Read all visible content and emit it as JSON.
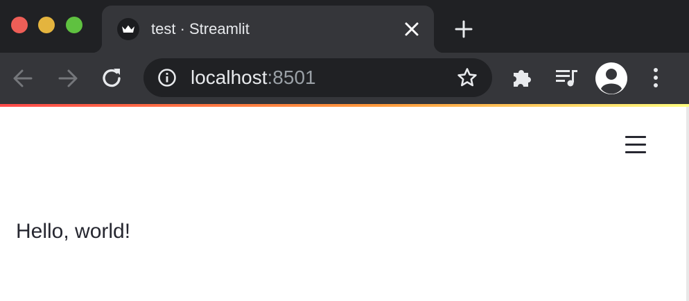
{
  "browser": {
    "tab": {
      "title": "test · Streamlit",
      "favicon": "streamlit-crown-icon"
    },
    "address_bar": {
      "host": "localhost",
      "port": ":8501"
    },
    "icons": {
      "back": "arrow-left-icon",
      "forward": "arrow-right-icon",
      "reload": "reload-icon",
      "info": "info-icon",
      "bookmark": "star-icon",
      "extensions": "puzzle-icon",
      "media": "media-queue-icon",
      "profile": "account-circle-icon",
      "menu": "kebab-menu-icon",
      "close_tab": "close-icon",
      "new_tab": "plus-icon"
    },
    "colors": {
      "tab_bar": "#202124",
      "toolbar": "#35363a",
      "text": "#e8eaed",
      "muted": "#9aa0a6"
    }
  },
  "app": {
    "body_text": "Hello, world!",
    "main_menu_icon": "hamburger-menu-icon",
    "colors": {
      "text": "#262730",
      "decoration_start": "#ff4b4b",
      "decoration_end": "#fffd80"
    }
  }
}
